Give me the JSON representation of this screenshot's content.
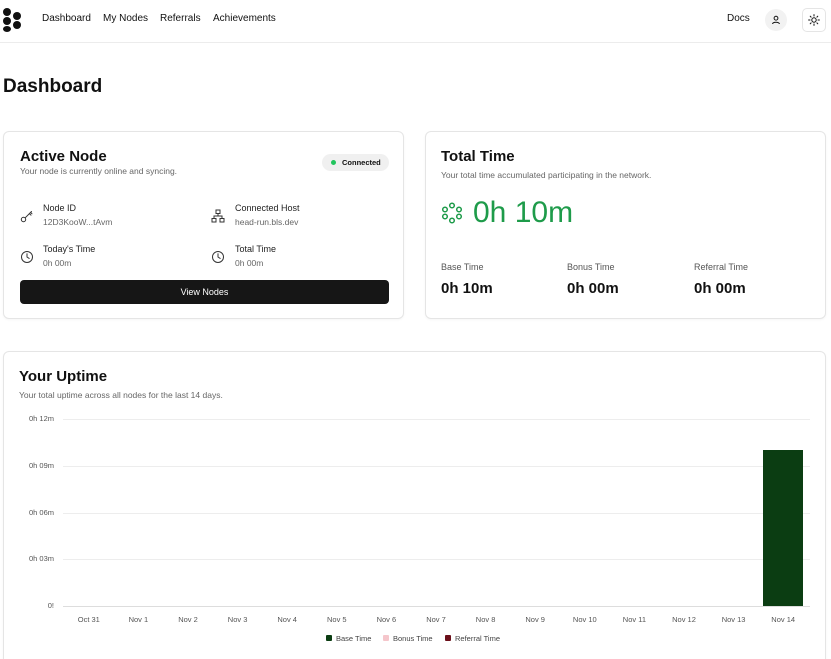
{
  "nav": {
    "links": [
      "Dashboard",
      "My Nodes",
      "Referrals",
      "Achievements"
    ],
    "docs": "Docs",
    "profile_icon": "user-icon",
    "theme_icon": "sun-icon"
  },
  "page": {
    "title": "Dashboard"
  },
  "active_node": {
    "title": "Active Node",
    "subtitle": "Your node is currently online and syncing.",
    "status": "Connected",
    "status_color": "#22c55e",
    "node_id_label": "Node ID",
    "node_id_value": "12D3KooW...tAvm",
    "host_label": "Connected Host",
    "host_value": "head-run.bls.dev",
    "today_label": "Today's Time",
    "today_value": "0h 00m",
    "total_label": "Total Time",
    "total_value": "0h 00m",
    "button": "View Nodes"
  },
  "total_time": {
    "title": "Total Time",
    "subtitle": "Your total time accumulated participating in the network.",
    "value": "0h 10m",
    "value_color": "#1e9b4a",
    "base_label": "Base Time",
    "base_value": "0h 10m",
    "bonus_label": "Bonus Time",
    "bonus_value": "0h 00m",
    "referral_label": "Referral Time",
    "referral_value": "0h 00m"
  },
  "uptime": {
    "title": "Your Uptime",
    "subtitle": "Your total uptime across all nodes for the last 14 days."
  },
  "chart_data": {
    "type": "bar",
    "stacked": true,
    "title": "",
    "xlabel": "",
    "ylabel": "",
    "ylim": [
      0,
      12
    ],
    "y_unit": "minutes",
    "y_ticks": [
      "0h 12m",
      "0h 09m",
      "0h 06m",
      "0h 03m",
      "0!"
    ],
    "grid": true,
    "legend_position": "bottom-center",
    "categories": [
      "Oct 31",
      "Nov 1",
      "Nov 2",
      "Nov 3",
      "Nov 4",
      "Nov 5",
      "Nov 6",
      "Nov 7",
      "Nov 8",
      "Nov 9",
      "Nov 10",
      "Nov 11",
      "Nov 12",
      "Nov 13",
      "Nov 14"
    ],
    "series": [
      {
        "name": "Base Time",
        "color": "#0b3d12",
        "values": [
          0,
          0,
          0,
          0,
          0,
          0,
          0,
          0,
          0,
          0,
          0,
          0,
          0,
          0,
          10
        ]
      },
      {
        "name": "Bonus Time",
        "color": "#f5c6cb",
        "values": [
          0,
          0,
          0,
          0,
          0,
          0,
          0,
          0,
          0,
          0,
          0,
          0,
          0,
          0,
          0
        ]
      },
      {
        "name": "Referral Time",
        "color": "#6b0f1a",
        "values": [
          0,
          0,
          0,
          0,
          0,
          0,
          0,
          0,
          0,
          0,
          0,
          0,
          0,
          0,
          0
        ]
      }
    ]
  }
}
